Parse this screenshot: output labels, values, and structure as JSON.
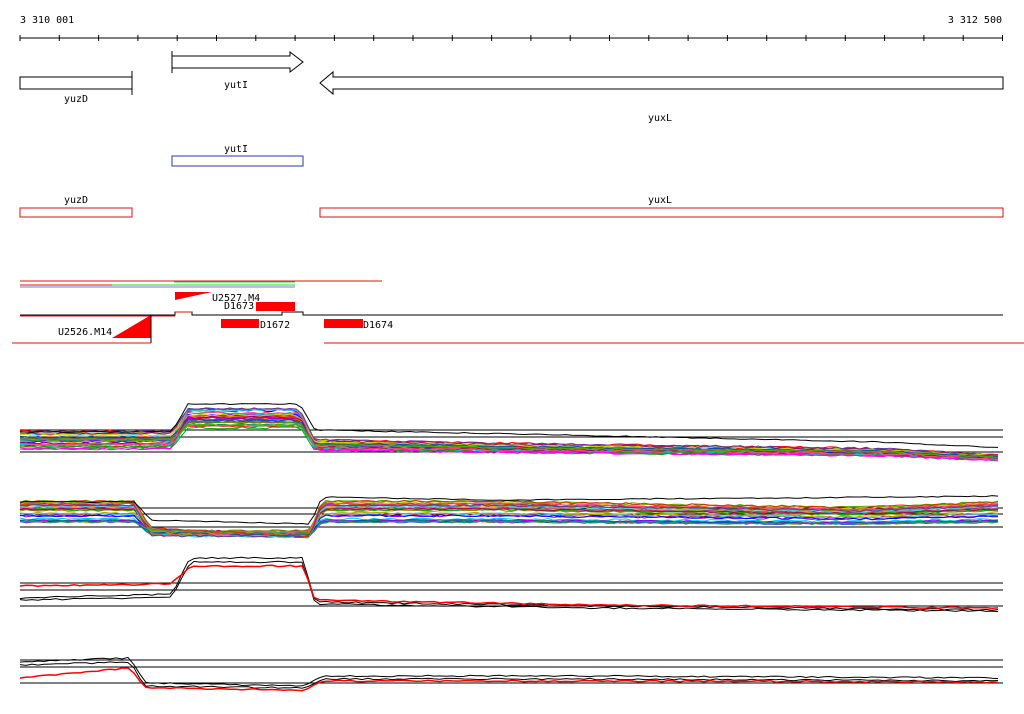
{
  "ruler": {
    "start_label": "3 310 001",
    "end_label": "3 312 500"
  },
  "annotations": {
    "genes": [
      {
        "name": "yuzD",
        "strand": "+",
        "style": "bar"
      },
      {
        "name": "yutI",
        "strand": "+",
        "style": "arrow"
      },
      {
        "name": "yuxL",
        "strand": "-",
        "style": "arrow"
      }
    ],
    "transcripts_blue": [
      {
        "name": "yutI"
      }
    ],
    "transcripts_red": [
      {
        "name": "yuzD"
      },
      {
        "name": "yuxL"
      }
    ]
  },
  "features": {
    "upstream_labels": [
      "U2527.M4",
      "U2526.M14"
    ],
    "downstream_labels": [
      "D1673",
      "D1672",
      "D1674"
    ]
  },
  "colors": {
    "gene_outline": "#000000",
    "transcript_blue": "#2b3b9c",
    "transcript_red": "#e01010",
    "feature_fill": "#ff0000",
    "track_green": "#33cc33",
    "profile_black": "#000000",
    "profile_red": "#ff0000"
  },
  "tracks": {
    "profile_tracks": 4,
    "multicolor_tracks": [
      "expression-track-1",
      "expression-track-2"
    ],
    "two_line_tracks": [
      "expression-track-3",
      "expression-track-4"
    ]
  }
}
